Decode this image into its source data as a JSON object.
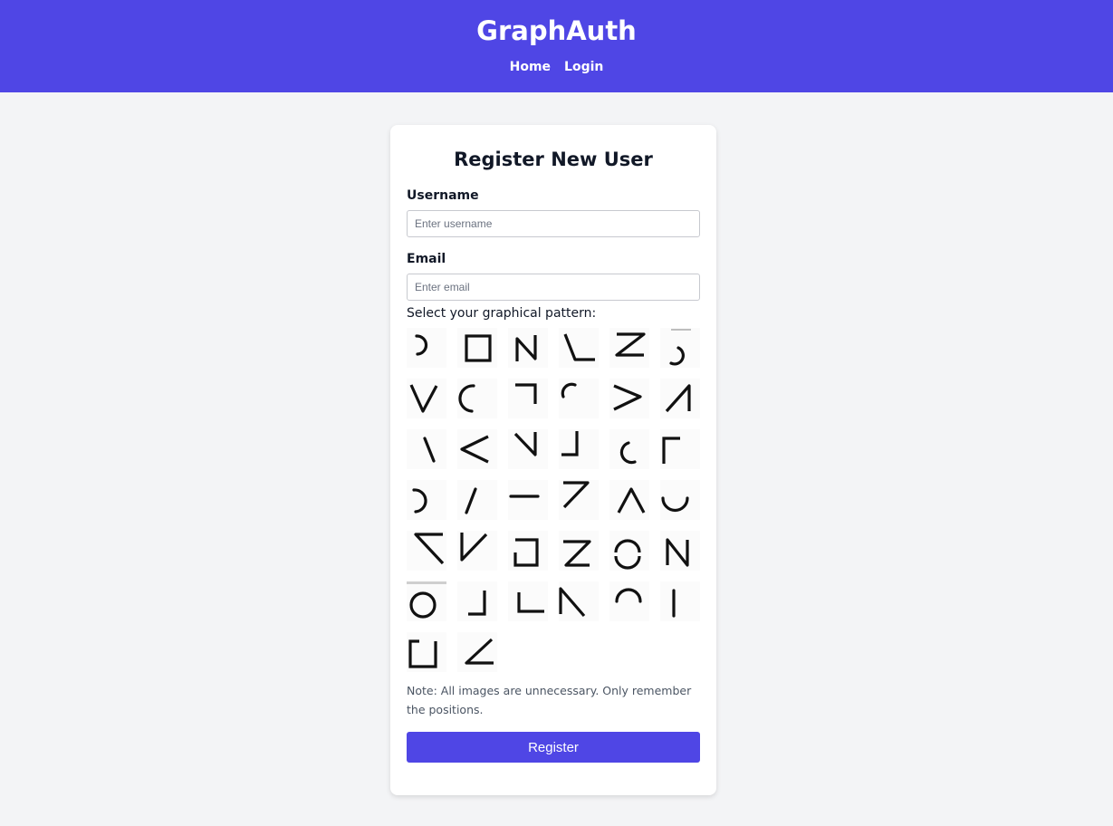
{
  "app": {
    "brand": "GraphAuth",
    "nav": [
      "Home",
      "Login"
    ]
  },
  "form": {
    "title": "Register New User",
    "username_label": "Username",
    "username_placeholder": "Enter username",
    "username_value": "",
    "email_label": "Email",
    "email_placeholder": "Enter email",
    "email_value": "",
    "pattern_label": "Select your graphical pattern:",
    "note": "Note: All images are unnecessary. Only remember the positions.",
    "submit_label": "Register"
  },
  "pattern_tiles": [
    "arc-right-glyph",
    "square-glyph",
    "n-glyph",
    "z-sideways-glyph",
    "z-glyph",
    "arc-hook-glyph",
    "v-glyph",
    "arc-left-glyph",
    "corner-top-right-glyph",
    "arc-small-left-glyph",
    "greater-than-glyph",
    "lambda-glyph",
    "backslash-glyph",
    "less-than-glyph",
    "check-reverse-glyph",
    "corner-bottom-right-glyph",
    "arc-small-c-glyph",
    "corner-top-left-glyph",
    "arc-d-glyph",
    "slash-glyph",
    "dash-glyph",
    "seven-glyph",
    "caret-glyph",
    "u-arc-glyph",
    "angle-top-left-glyph",
    "v-check-glyph",
    "square-open-glyph",
    "z-flat-glyph",
    "circle-broken-glyph",
    "n-large-glyph",
    "circle-open-glyph",
    "corner-small-bottom-right-glyph",
    "l-glyph",
    "triangle-up-left-glyph",
    "arch-glyph",
    "vertical-bar-glyph",
    "square-bracket-glyph",
    "angle-bottom-left-glyph"
  ]
}
